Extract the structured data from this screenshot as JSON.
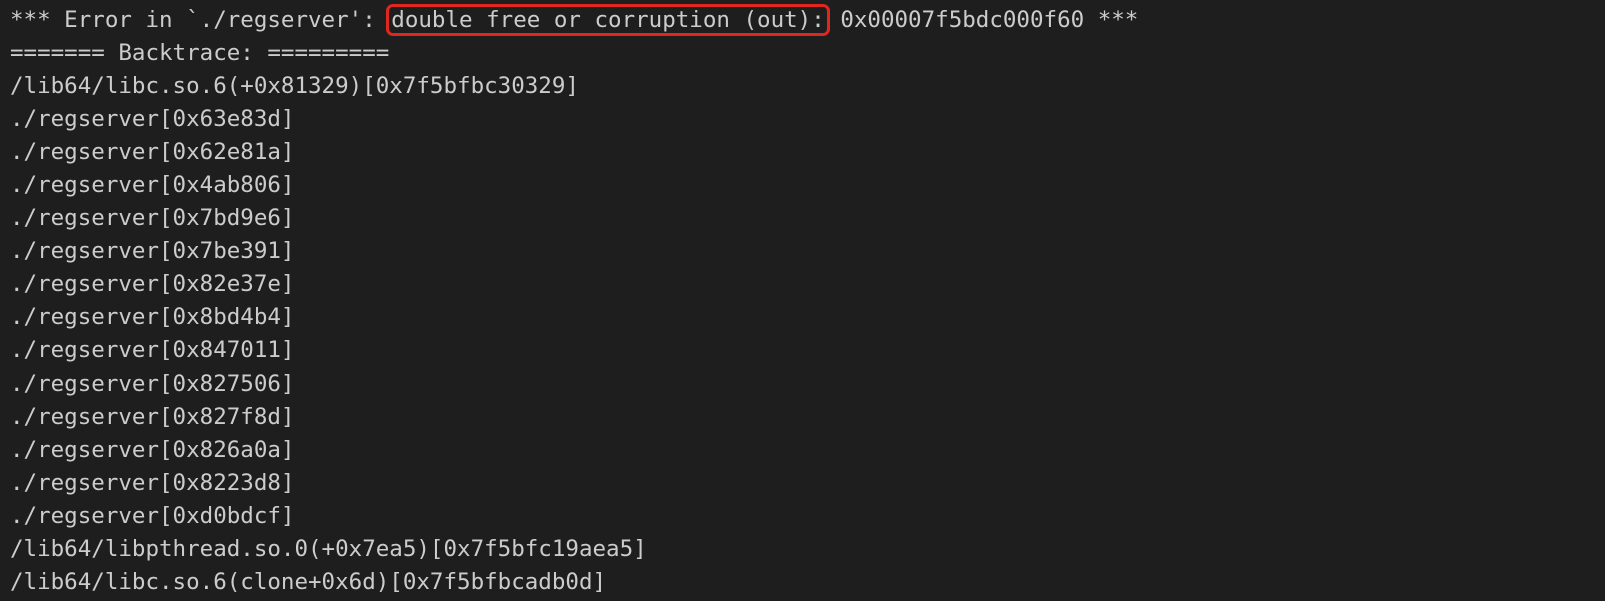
{
  "terminal": {
    "partial_top_line": "",
    "error_prefix": "*** Error in `./regserver': ",
    "error_highlight": "double free or corruption (out):",
    "error_suffix": " 0x00007f5bdc000f60 ***",
    "lines": [
      "======= Backtrace: =========",
      "/lib64/libc.so.6(+0x81329)[0x7f5bfbc30329]",
      "./regserver[0x63e83d]",
      "./regserver[0x62e81a]",
      "./regserver[0x4ab806]",
      "./regserver[0x7bd9e6]",
      "./regserver[0x7be391]",
      "./regserver[0x82e37e]",
      "./regserver[0x8bd4b4]",
      "./regserver[0x847011]",
      "./regserver[0x827506]",
      "./regserver[0x827f8d]",
      "./regserver[0x826a0a]",
      "./regserver[0x8223d8]",
      "./regserver[0xd0bdcf]",
      "/lib64/libpthread.so.0(+0x7ea5)[0x7f5bfc19aea5]",
      "/lib64/libc.so.6(clone+0x6d)[0x7f5bfbcadb0d]"
    ],
    "colors": {
      "background": "#1e1e1e",
      "text": "#cccccc",
      "highlight_border": "#e0261f"
    }
  }
}
